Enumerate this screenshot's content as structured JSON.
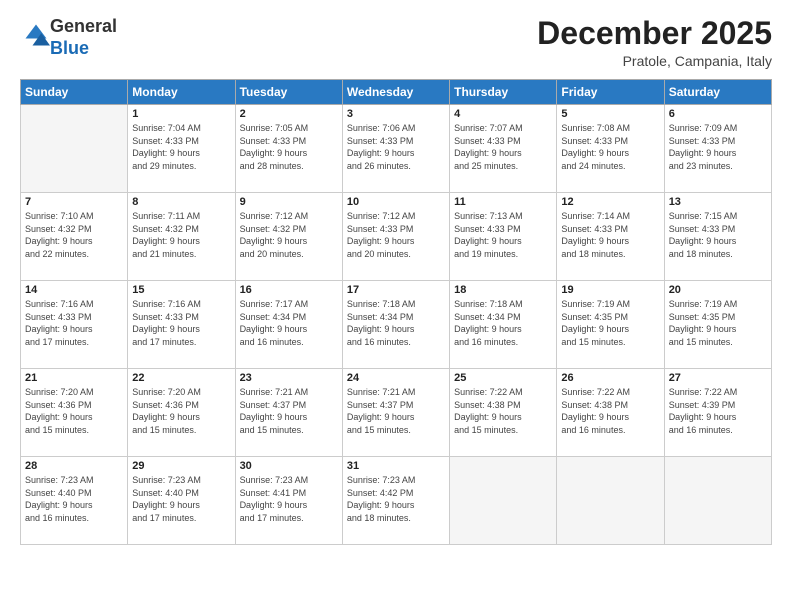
{
  "logo": {
    "general": "General",
    "blue": "Blue"
  },
  "title": "December 2025",
  "subtitle": "Pratole, Campania, Italy",
  "weekdays": [
    "Sunday",
    "Monday",
    "Tuesday",
    "Wednesday",
    "Thursday",
    "Friday",
    "Saturday"
  ],
  "weeks": [
    [
      {
        "day": "",
        "info": ""
      },
      {
        "day": "1",
        "info": "Sunrise: 7:04 AM\nSunset: 4:33 PM\nDaylight: 9 hours\nand 29 minutes."
      },
      {
        "day": "2",
        "info": "Sunrise: 7:05 AM\nSunset: 4:33 PM\nDaylight: 9 hours\nand 28 minutes."
      },
      {
        "day": "3",
        "info": "Sunrise: 7:06 AM\nSunset: 4:33 PM\nDaylight: 9 hours\nand 26 minutes."
      },
      {
        "day": "4",
        "info": "Sunrise: 7:07 AM\nSunset: 4:33 PM\nDaylight: 9 hours\nand 25 minutes."
      },
      {
        "day": "5",
        "info": "Sunrise: 7:08 AM\nSunset: 4:33 PM\nDaylight: 9 hours\nand 24 minutes."
      },
      {
        "day": "6",
        "info": "Sunrise: 7:09 AM\nSunset: 4:33 PM\nDaylight: 9 hours\nand 23 minutes."
      }
    ],
    [
      {
        "day": "7",
        "info": "Sunrise: 7:10 AM\nSunset: 4:32 PM\nDaylight: 9 hours\nand 22 minutes."
      },
      {
        "day": "8",
        "info": "Sunrise: 7:11 AM\nSunset: 4:32 PM\nDaylight: 9 hours\nand 21 minutes."
      },
      {
        "day": "9",
        "info": "Sunrise: 7:12 AM\nSunset: 4:32 PM\nDaylight: 9 hours\nand 20 minutes."
      },
      {
        "day": "10",
        "info": "Sunrise: 7:12 AM\nSunset: 4:33 PM\nDaylight: 9 hours\nand 20 minutes."
      },
      {
        "day": "11",
        "info": "Sunrise: 7:13 AM\nSunset: 4:33 PM\nDaylight: 9 hours\nand 19 minutes."
      },
      {
        "day": "12",
        "info": "Sunrise: 7:14 AM\nSunset: 4:33 PM\nDaylight: 9 hours\nand 18 minutes."
      },
      {
        "day": "13",
        "info": "Sunrise: 7:15 AM\nSunset: 4:33 PM\nDaylight: 9 hours\nand 18 minutes."
      }
    ],
    [
      {
        "day": "14",
        "info": "Sunrise: 7:16 AM\nSunset: 4:33 PM\nDaylight: 9 hours\nand 17 minutes."
      },
      {
        "day": "15",
        "info": "Sunrise: 7:16 AM\nSunset: 4:33 PM\nDaylight: 9 hours\nand 17 minutes."
      },
      {
        "day": "16",
        "info": "Sunrise: 7:17 AM\nSunset: 4:34 PM\nDaylight: 9 hours\nand 16 minutes."
      },
      {
        "day": "17",
        "info": "Sunrise: 7:18 AM\nSunset: 4:34 PM\nDaylight: 9 hours\nand 16 minutes."
      },
      {
        "day": "18",
        "info": "Sunrise: 7:18 AM\nSunset: 4:34 PM\nDaylight: 9 hours\nand 16 minutes."
      },
      {
        "day": "19",
        "info": "Sunrise: 7:19 AM\nSunset: 4:35 PM\nDaylight: 9 hours\nand 15 minutes."
      },
      {
        "day": "20",
        "info": "Sunrise: 7:19 AM\nSunset: 4:35 PM\nDaylight: 9 hours\nand 15 minutes."
      }
    ],
    [
      {
        "day": "21",
        "info": "Sunrise: 7:20 AM\nSunset: 4:36 PM\nDaylight: 9 hours\nand 15 minutes."
      },
      {
        "day": "22",
        "info": "Sunrise: 7:20 AM\nSunset: 4:36 PM\nDaylight: 9 hours\nand 15 minutes."
      },
      {
        "day": "23",
        "info": "Sunrise: 7:21 AM\nSunset: 4:37 PM\nDaylight: 9 hours\nand 15 minutes."
      },
      {
        "day": "24",
        "info": "Sunrise: 7:21 AM\nSunset: 4:37 PM\nDaylight: 9 hours\nand 15 minutes."
      },
      {
        "day": "25",
        "info": "Sunrise: 7:22 AM\nSunset: 4:38 PM\nDaylight: 9 hours\nand 15 minutes."
      },
      {
        "day": "26",
        "info": "Sunrise: 7:22 AM\nSunset: 4:38 PM\nDaylight: 9 hours\nand 16 minutes."
      },
      {
        "day": "27",
        "info": "Sunrise: 7:22 AM\nSunset: 4:39 PM\nDaylight: 9 hours\nand 16 minutes."
      }
    ],
    [
      {
        "day": "28",
        "info": "Sunrise: 7:23 AM\nSunset: 4:40 PM\nDaylight: 9 hours\nand 16 minutes."
      },
      {
        "day": "29",
        "info": "Sunrise: 7:23 AM\nSunset: 4:40 PM\nDaylight: 9 hours\nand 17 minutes."
      },
      {
        "day": "30",
        "info": "Sunrise: 7:23 AM\nSunset: 4:41 PM\nDaylight: 9 hours\nand 17 minutes."
      },
      {
        "day": "31",
        "info": "Sunrise: 7:23 AM\nSunset: 4:42 PM\nDaylight: 9 hours\nand 18 minutes."
      },
      {
        "day": "",
        "info": ""
      },
      {
        "day": "",
        "info": ""
      },
      {
        "day": "",
        "info": ""
      }
    ]
  ]
}
